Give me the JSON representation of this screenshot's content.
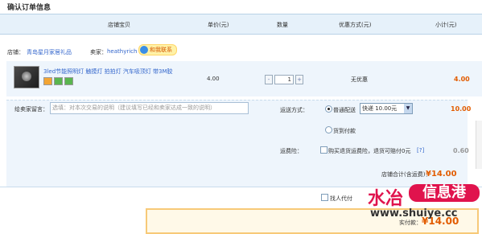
{
  "page_title": "确认订单信息",
  "columns": {
    "item": "店铺宝贝",
    "unit_price": "单价(元)",
    "quantity": "数量",
    "discount": "优惠方式(元)",
    "subtotal": "小计(元)"
  },
  "shop": {
    "label": "店铺：",
    "name": "青岛星月家居礼品",
    "seller_label": "卖家：",
    "seller_name": "heathyrich",
    "contact_label": "和我联系"
  },
  "item": {
    "title": "3led节能照明灯 触摸灯 拍拍灯 汽车吸顶灯 带3M胶",
    "price": "4.00",
    "quantity": "1",
    "discount": "无优惠",
    "subtotal": "4.00",
    "qty_minus": "-",
    "qty_plus": "+"
  },
  "message": {
    "label": "给卖家留言：",
    "placeholder": "选填：对本次交易的说明（建议填写已经和卖家达成一致的说明）"
  },
  "shipping": {
    "label": "运送方式：",
    "option1": "普通配送",
    "option2": "货到付款",
    "selected": "快递 10.00元",
    "fee": "10.00"
  },
  "insurance": {
    "label": "运费险：",
    "text": "购买退货运费险，退货可赔付0元",
    "help": "[?]",
    "fee": "0.60"
  },
  "total": {
    "label": "店铺合计(含运费)：",
    "value": "¥14.00"
  },
  "proxy": {
    "label": "找人代付"
  },
  "payment": {
    "label": "实付款：",
    "value": "¥14.00"
  },
  "watermark": {
    "part1": "水冶",
    "part2": "信息港",
    "url": "www.shuiye.cc"
  }
}
